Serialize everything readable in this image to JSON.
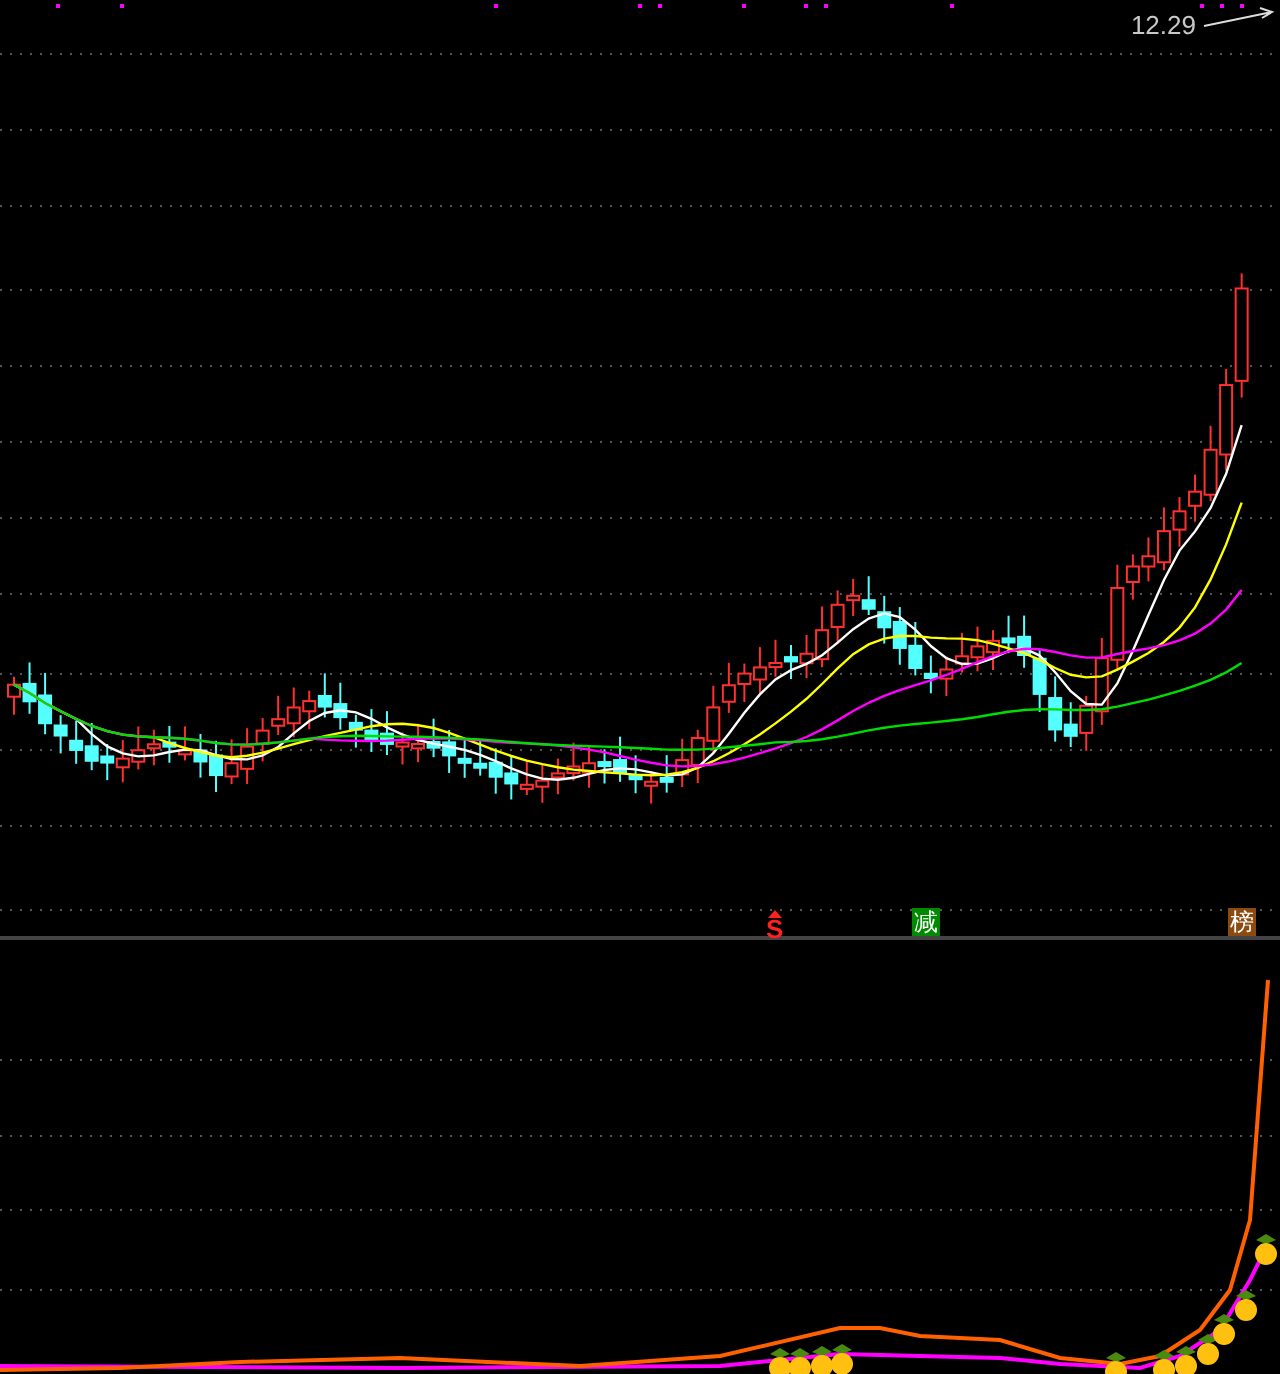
{
  "price_label": {
    "text": "12.29"
  },
  "signals": [
    {
      "kind": "arrow-letter",
      "text": "S",
      "color": "#ff2020"
    },
    {
      "kind": "box",
      "text": "减",
      "color": "#008a00"
    },
    {
      "kind": "box",
      "text": "榜",
      "color": "#8b4a10"
    }
  ]
}
